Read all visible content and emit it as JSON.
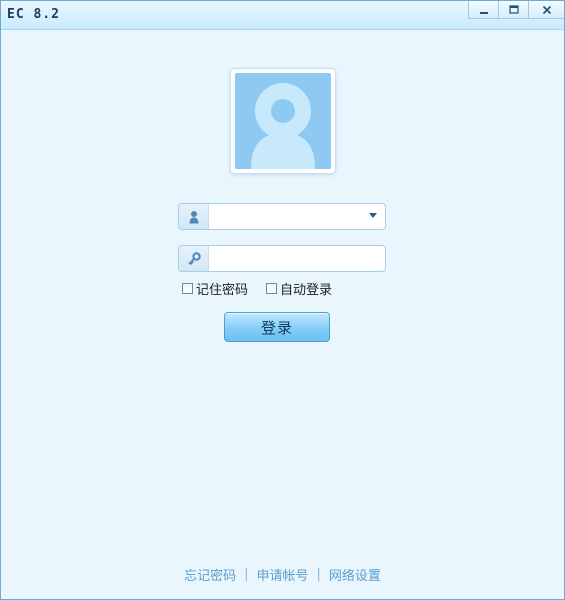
{
  "window": {
    "title": "EC 8.2",
    "minimize_label": "minimize",
    "maximize_label": "maximize",
    "close_label": "close"
  },
  "login": {
    "username_value": "",
    "password_value": "",
    "remember_label": "记住密码",
    "remember_checked": false,
    "autologin_label": "自动登录",
    "autologin_checked": false,
    "submit_label": "登录"
  },
  "footer": {
    "links": [
      "忘记密码",
      "申请帐号",
      "网络设置"
    ],
    "separator": "|"
  },
  "colors": {
    "window_bg": "#e9f6fe",
    "accent": "#84cdf7",
    "avatar_bg": "#8ec9f1",
    "link": "#5c9fcf"
  }
}
